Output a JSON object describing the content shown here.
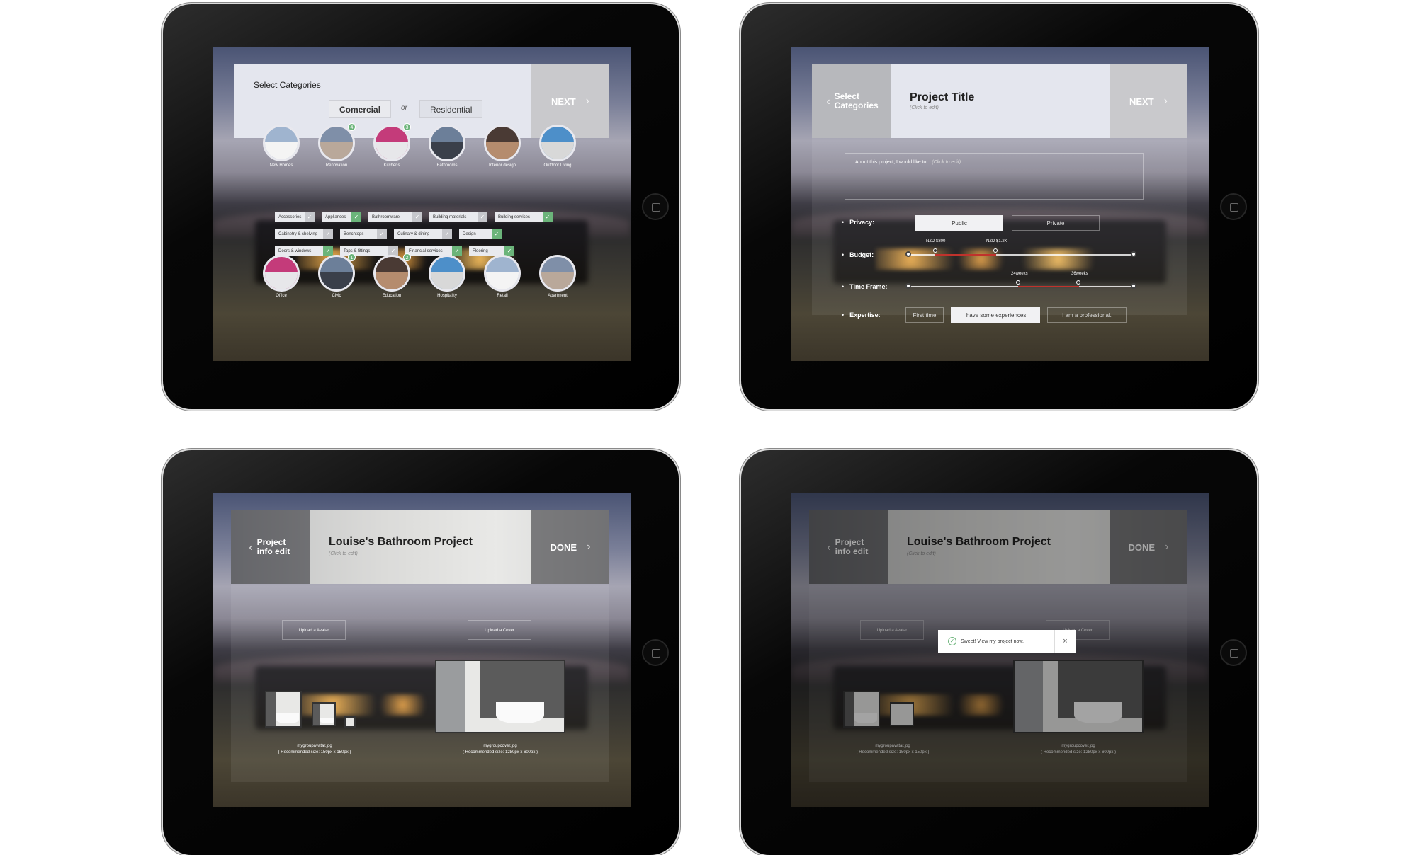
{
  "screen1": {
    "title": "Select Categories",
    "commercial": "Comercial",
    "or": "or",
    "residential": "Residential",
    "next": "NEXT",
    "residential_categories": [
      {
        "label": "New Homes",
        "badge": ""
      },
      {
        "label": "Renovation",
        "badge": "4"
      },
      {
        "label": "Kitchens",
        "badge": "3"
      },
      {
        "label": "Bathrooms",
        "badge": ""
      },
      {
        "label": "Interior design",
        "badge": ""
      },
      {
        "label": "Outdoor Living",
        "badge": ""
      }
    ],
    "tags": [
      [
        {
          "label": "Accessories",
          "checked": false
        },
        {
          "label": "Appliances",
          "checked": true
        },
        {
          "label": "Bathroomware",
          "checked": false
        },
        {
          "label": "Building materials",
          "checked": false
        },
        {
          "label": "Building services",
          "checked": true
        }
      ],
      [
        {
          "label": "Cabinetry & shelving",
          "checked": false
        },
        {
          "label": "Benchtops",
          "checked": false
        },
        {
          "label": "Culinary & dining",
          "checked": false
        },
        {
          "label": "Design",
          "checked": true
        }
      ],
      [
        {
          "label": "Doors & windows",
          "checked": true
        },
        {
          "label": "Taps & fittings",
          "checked": false
        },
        {
          "label": "Financial services",
          "checked": true
        },
        {
          "label": "Flooring",
          "checked": true
        }
      ]
    ],
    "commercial_categories": [
      {
        "label": "Office",
        "badge": ""
      },
      {
        "label": "Civic",
        "badge": "1"
      },
      {
        "label": "Education",
        "badge": "2"
      },
      {
        "label": "Hospitality",
        "badge": ""
      },
      {
        "label": "Retail",
        "badge": ""
      },
      {
        "label": "Apartment",
        "badge": ""
      }
    ]
  },
  "screen2": {
    "prev": "Select Categories",
    "title": "Project Title",
    "click_to_edit": "(Click to edit)",
    "next": "NEXT",
    "about_label": "About this project, I would like to...",
    "about_hint": "(Click to edit)",
    "privacy_label": "Privacy:",
    "privacy_public": "Public",
    "privacy_private": "Private",
    "privacy_selected": "Public",
    "budget_label": "Budget:",
    "budget_min": "NZD $800",
    "budget_max": "NZD $1.2K",
    "timeframe_label": "Time Frame:",
    "time_min": "24weeks",
    "time_max": "36weeks",
    "expertise_label": "Expertise:",
    "expertise_options": [
      "First time",
      "I have some experiences.",
      "I am a professional."
    ],
    "expertise_selected": "I have some experiences."
  },
  "screen3": {
    "prev": "Project info edit",
    "title": "Louise's Bathroom Project",
    "click_to_edit": "(Click to edit)",
    "done": "DONE",
    "upload_avatar": "Upload a Avatar",
    "upload_cover": "Upload a Cover",
    "avatar_file": "mygroupavatar.jpg",
    "avatar_size": "( Recommended size: 150px x 150px )",
    "cover_file": "mygroupcover.jpg",
    "cover_size": "( Recommended size: 1280px x 600px )"
  },
  "screen4": {
    "prev": "Project info edit",
    "title": "Louise's Bathroom Project",
    "click_to_edit": "(Click to edit)",
    "done": "DONE",
    "upload_avatar": "Upload a Avatar",
    "upload_cover": "Upload a Cover",
    "toast": "Sweet! View my project now.",
    "avatar_file": "mygroupavatar.jpg",
    "avatar_size": "( Recommended size: 150px x 150px )",
    "cover_file": "mygroupcover.jpg",
    "cover_size": "( Recommended size: 1280px x 600px )"
  }
}
